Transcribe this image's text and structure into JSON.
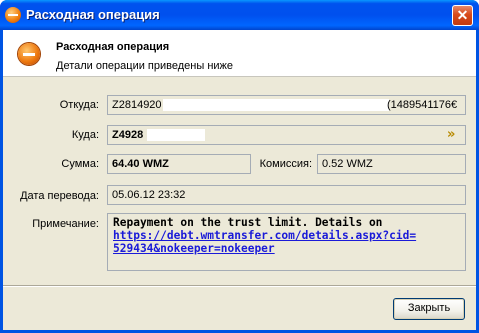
{
  "window": {
    "title": "Расходная операция",
    "close_glyph": "✕"
  },
  "header": {
    "title": "Расходная операция",
    "subtitle": "Детали операции приведены ниже",
    "icon": "minus-circle-icon"
  },
  "form": {
    "from_label": "Откуда:",
    "from_value": "Z2814920",
    "from_suffix": "(1489541176€",
    "to_label": "Куда:",
    "to_value": "Z4928",
    "sum_label": "Сумма:",
    "sum_value": "64.40 WMZ",
    "commission_label": "Комиссия:",
    "commission_value": "0.52 WMZ",
    "date_label": "Дата перевода:",
    "date_value": "05.06.12 23:32",
    "note_label": "Примечание:",
    "note_text": "Repayment on the trust limit. Details on",
    "note_link_line1": "https://debt.wmtransfer.com/details.aspx?cid=",
    "note_link_line2": "529434&nokeeper=nokeeper"
  },
  "footer": {
    "close_label": "Закрыть"
  },
  "colors": {
    "titlebar": "#0050ee",
    "client_bg": "#ece9d8",
    "link": "#1a1ad8",
    "arrow": "#b88a00"
  }
}
